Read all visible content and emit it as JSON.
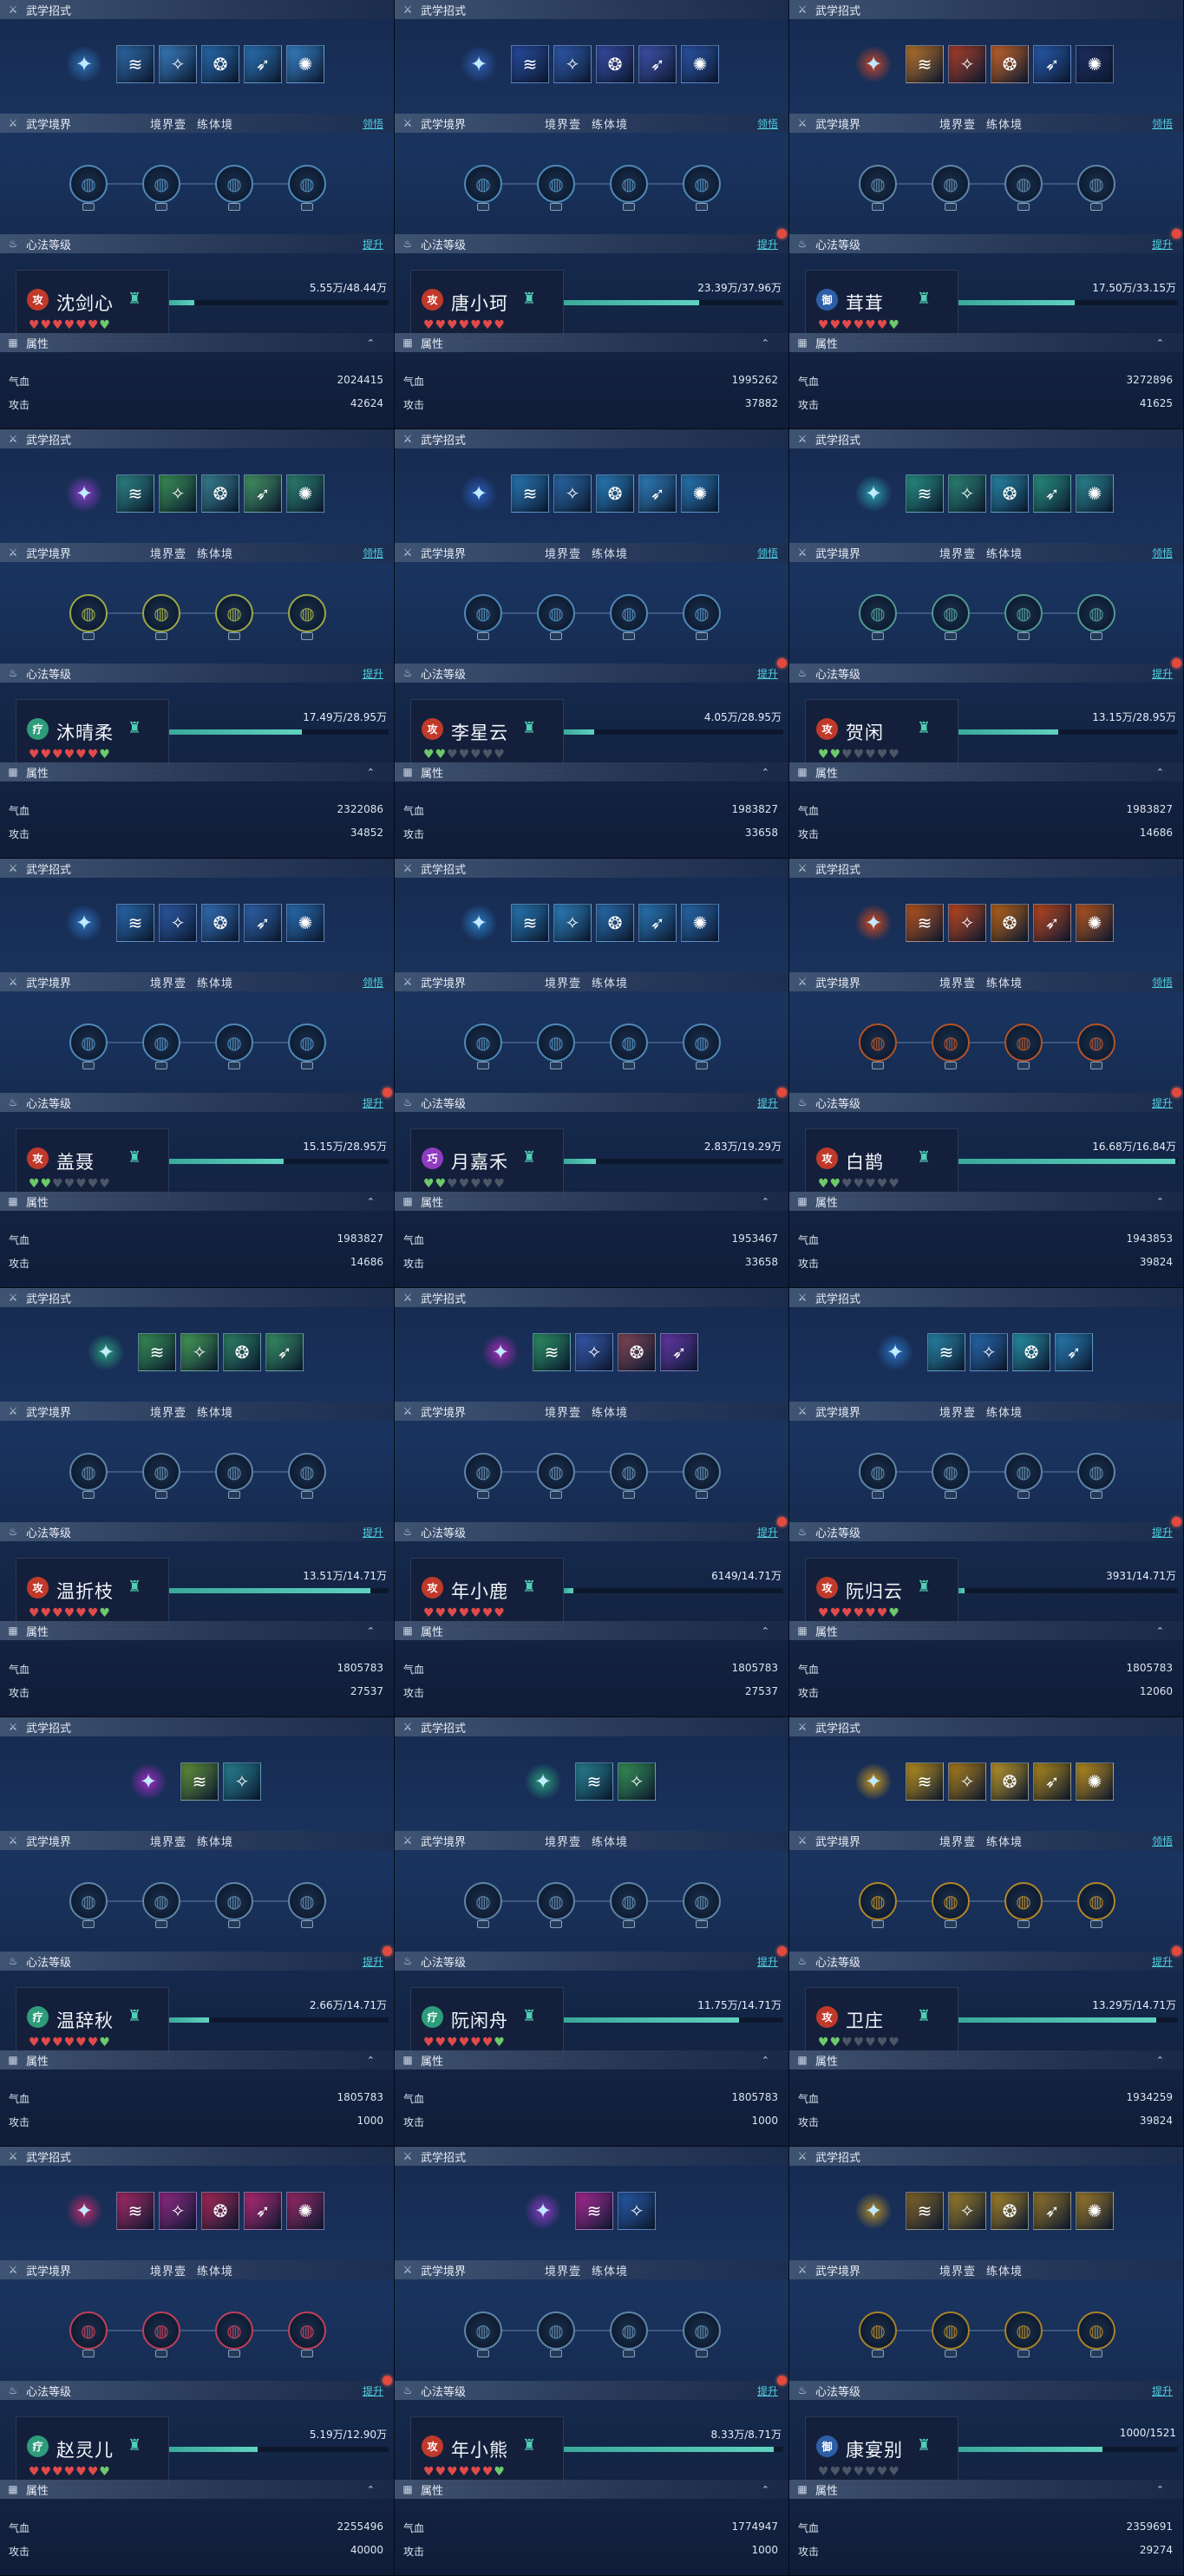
{
  "labels": {
    "skills": "武学招式",
    "realm": "武学境界",
    "realm_options": [
      "境界壹",
      "练体境"
    ],
    "realm_link": "领悟",
    "heart": "心法等级",
    "heart_link": "提升",
    "attr": "属性",
    "hp": "气血",
    "atk": "攻击"
  },
  "colors": {
    "badge_attack": "#c0392b",
    "badge_heal": "#2e9c7a",
    "badge_defense": "#2d5fa8",
    "badge_purple": "#8f3cc2",
    "heart_red": "#e24a4a",
    "heart_green": "#6ec96a",
    "heart_gray": "#4d5566",
    "progress": "#4fc7b0"
  },
  "heroes": [
    {
      "name": "沈剑心",
      "badge": "攻",
      "badge_color": "#c0392b",
      "hearts": [
        "r",
        "r",
        "r",
        "r",
        "r",
        "r",
        "g"
      ],
      "progress_text": "5.55万/48.44万",
      "progress": 0.115,
      "hp": "2024415",
      "atk": "42624",
      "has_dot": false,
      "realm_has_link": true,
      "skill_count": 5,
      "skill_colors": [
        "#2f6fb0",
        "#3c85c9",
        "#2a71b8",
        "#2d7ac0",
        "#3a8ad3"
      ],
      "main_color": "#2d6fb2",
      "node_color": "#4f89b8"
    },
    {
      "name": "唐小珂",
      "badge": "攻",
      "badge_color": "#c0392b",
      "hearts": [
        "r",
        "r",
        "r",
        "r",
        "r",
        "r",
        "r"
      ],
      "progress_text": "23.39万/37.96万",
      "progress": 0.616,
      "hp": "1995262",
      "atk": "37882",
      "has_dot": true,
      "realm_has_link": true,
      "skill_count": 5,
      "skill_colors": [
        "#2a4fa8",
        "#3260b9",
        "#3a4fae",
        "#4357b6",
        "#2c59b0"
      ],
      "main_color": "#2f5db0",
      "node_color": "#4f89b8"
    },
    {
      "name": "茸茸",
      "badge": "御",
      "badge_color": "#2d5fa8",
      "hearts": [
        "r",
        "r",
        "r",
        "r",
        "r",
        "r",
        "g"
      ],
      "progress_text": "17.50万/33.15万",
      "progress": 0.528,
      "hp": "3272896",
      "atk": "41625",
      "has_dot": true,
      "realm_has_link": true,
      "skill_count": 5,
      "skill_colors": [
        "#c47a2a",
        "#b7412a",
        "#d36a2a",
        "#2a5fb6",
        "#1e2e63"
      ],
      "main_color": "#c2452a",
      "node_color": "#5f86a8"
    },
    {
      "name": "沐晴柔",
      "badge": "疗",
      "badge_color": "#2e9c7a",
      "hearts": [
        "r",
        "r",
        "r",
        "r",
        "r",
        "r",
        "g"
      ],
      "progress_text": "17.49万/28.95万",
      "progress": 0.604,
      "hp": "2322086",
      "atk": "34852",
      "has_dot": false,
      "realm_has_link": true,
      "skill_count": 5,
      "skill_colors": [
        "#2f8f8a",
        "#3e9a5a",
        "#3c8a9a",
        "#4aa068",
        "#2f8a76"
      ],
      "main_color": "#8a3cc6",
      "node_color": "#9aa848"
    },
    {
      "name": "李星云",
      "badge": "攻",
      "badge_color": "#c0392b",
      "hearts": [
        "g",
        "g",
        "x",
        "x",
        "x",
        "x",
        "x"
      ],
      "progress_text": "4.05万/28.95万",
      "progress": 0.14,
      "hp": "1983827",
      "atk": "33658",
      "has_dot": true,
      "realm_has_link": true,
      "skill_count": 5,
      "skill_colors": [
        "#2a7fc0",
        "#2c6fb0",
        "#2a86c6",
        "#3488c8",
        "#2a7fbf"
      ],
      "main_color": "#2a5bb8",
      "node_color": "#4f89b8"
    },
    {
      "name": "贺闲",
      "badge": "攻",
      "badge_color": "#c0392b",
      "hearts": [
        "g",
        "g",
        "x",
        "x",
        "x",
        "x",
        "x"
      ],
      "progress_text": "13.15万/28.95万",
      "progress": 0.454,
      "hp": "1983827",
      "atk": "14686",
      "has_dot": true,
      "realm_has_link": true,
      "skill_count": 5,
      "skill_colors": [
        "#2a9a8a",
        "#2e8f7a",
        "#2a8fb0",
        "#2a9a86",
        "#2f8f9a"
      ],
      "main_color": "#2a9aaa",
      "node_color": "#4f9a92"
    },
    {
      "name": "盖聂",
      "badge": "攻",
      "badge_color": "#c0392b",
      "hearts": [
        "g",
        "g",
        "x",
        "x",
        "x",
        "x",
        "x"
      ],
      "progress_text": "15.15万/28.95万",
      "progress": 0.523,
      "hp": "1983827",
      "atk": "14686",
      "has_dot": true,
      "realm_has_link": true,
      "skill_count": 5,
      "skill_colors": [
        "#2a6fb8",
        "#2f5fb0",
        "#3576c2",
        "#3269b6",
        "#2a74bd"
      ],
      "main_color": "#2d6fbc",
      "node_color": "#4f89b8"
    },
    {
      "name": "月嘉禾",
      "badge": "巧",
      "badge_color": "#8f3cc2",
      "hearts": [
        "g",
        "g",
        "x",
        "x",
        "x",
        "x",
        "x"
      ],
      "progress_text": "2.83万/19.29万",
      "progress": 0.147,
      "hp": "1953467",
      "atk": "33658",
      "has_dot": true,
      "realm_has_link": false,
      "skill_count": 5,
      "skill_colors": [
        "#2a7fbf",
        "#2f8ac8",
        "#2a74b8",
        "#2b80c2",
        "#2a6fb6"
      ],
      "main_color": "#2a7abf",
      "node_color": "#4f89b8"
    },
    {
      "name": "白鹊",
      "badge": "攻",
      "badge_color": "#c0392b",
      "hearts": [
        "g",
        "g",
        "x",
        "x",
        "x",
        "x",
        "x"
      ],
      "progress_text": "16.68万/16.84万",
      "progress": 0.99,
      "hp": "1943853",
      "atk": "39824",
      "has_dot": true,
      "realm_has_link": true,
      "skill_count": 5,
      "skill_colors": [
        "#c65a1e",
        "#cc4a1e",
        "#c46a1a",
        "#c84a1e",
        "#c25a1e"
      ],
      "main_color": "#d0481e",
      "node_color": "#b2542a"
    },
    {
      "name": "温折枝",
      "badge": "攻",
      "badge_color": "#c0392b",
      "hearts": [
        "r",
        "r",
        "r",
        "r",
        "r",
        "r",
        "g"
      ],
      "progress_text": "13.51万/14.71万",
      "progress": 0.918,
      "hp": "1805783",
      "atk": "27537",
      "has_dot": false,
      "realm_has_link": false,
      "skill_count": 4,
      "skill_colors": [
        "#3a9a5a",
        "#4aa85a",
        "#2f8a6a",
        "#3a9a6a"
      ],
      "main_color": "#2a9a7a",
      "node_color": "#5f86a8"
    },
    {
      "name": "年小鹿",
      "badge": "攻",
      "badge_color": "#c0392b",
      "hearts": [
        "r",
        "r",
        "r",
        "r",
        "r",
        "r",
        "r"
      ],
      "progress_text": "6149/14.71万",
      "progress": 0.042,
      "hp": "1805783",
      "atk": "27537",
      "has_dot": true,
      "realm_has_link": false,
      "skill_count": 4,
      "skill_colors": [
        "#2f9a6a",
        "#3a5fb8",
        "#8a4a5a",
        "#6a3ab0"
      ],
      "main_color": "#a82ab8",
      "node_color": "#5f86a8"
    },
    {
      "name": "阮归云",
      "badge": "攻",
      "badge_color": "#c0392b",
      "hearts": [
        "r",
        "r",
        "r",
        "r",
        "r",
        "r",
        "g"
      ],
      "progress_text": "3931/14.71万",
      "progress": 0.027,
      "hp": "1805783",
      "atk": "12060",
      "has_dot": true,
      "realm_has_link": false,
      "skill_count": 4,
      "skill_colors": [
        "#2a8fb0",
        "#2a6fb8",
        "#2a9ab0",
        "#2a86c0"
      ],
      "main_color": "#2a6fbf",
      "node_color": "#5f86a8"
    },
    {
      "name": "温辞秋",
      "badge": "疗",
      "badge_color": "#2e9c7a",
      "hearts": [
        "r",
        "r",
        "r",
        "r",
        "r",
        "r",
        "g"
      ],
      "progress_text": "2.66万/14.71万",
      "progress": 0.181,
      "hp": "1805783",
      "atk": "1000",
      "has_dot": true,
      "realm_has_link": false,
      "skill_count": 2,
      "skill_colors": [
        "#6a9a3a",
        "#2a8a9a"
      ],
      "main_color": "#a02ac0",
      "node_color": "#5f86a8"
    },
    {
      "name": "阮闲舟",
      "badge": "疗",
      "badge_color": "#2e9c7a",
      "hearts": [
        "r",
        "r",
        "r",
        "r",
        "r",
        "r",
        "g"
      ],
      "progress_text": "11.75万/14.71万",
      "progress": 0.799,
      "hp": "1805783",
      "atk": "1000",
      "has_dot": true,
      "realm_has_link": false,
      "skill_count": 2,
      "skill_colors": [
        "#2a8a9a",
        "#3a9a5a"
      ],
      "main_color": "#2a9a7a",
      "node_color": "#5f86a8"
    },
    {
      "name": "卫庄",
      "badge": "攻",
      "badge_color": "#c0392b",
      "hearts": [
        "g",
        "g",
        "x",
        "x",
        "x",
        "x",
        "x"
      ],
      "progress_text": "13.29万/14.71万",
      "progress": 0.903,
      "hp": "1934259",
      "atk": "39824",
      "has_dot": true,
      "realm_has_link": true,
      "skill_count": 5,
      "skill_colors": [
        "#c89a1e",
        "#b8861a",
        "#c8a02a",
        "#b8901a",
        "#c8961e"
      ],
      "main_color": "#c8941a",
      "node_color": "#b2862a"
    },
    {
      "name": "赵灵儿",
      "badge": "疗",
      "badge_color": "#2e9c7a",
      "hearts": [
        "r",
        "r",
        "r",
        "r",
        "r",
        "r",
        "g"
      ],
      "progress_text": "5.19万/12.90万",
      "progress": 0.402,
      "hp": "2255496",
      "atk": "40000",
      "has_dot": true,
      "realm_has_link": false,
      "skill_count": 5,
      "skill_colors": [
        "#b02a6a",
        "#9a2a8a",
        "#b02a5a",
        "#c02a7a",
        "#a02a6a"
      ],
      "main_color": "#c02a6a",
      "node_color": "#c0405a"
    },
    {
      "name": "年小熊",
      "badge": "攻",
      "badge_color": "#c0392b",
      "hearts": [
        "r",
        "r",
        "r",
        "r",
        "r",
        "r",
        "g"
      ],
      "progress_text": "8.33万/8.71万",
      "progress": 0.956,
      "hp": "1774947",
      "atk": "1000",
      "has_dot": true,
      "realm_has_link": false,
      "skill_count": 2,
      "skill_colors": [
        "#b02a9a",
        "#2a5fb0"
      ],
      "main_color": "#8a3ac6",
      "node_color": "#5f86a8"
    },
    {
      "name": "康宴别",
      "badge": "御",
      "badge_color": "#2d5fa8",
      "hearts": [
        "x",
        "x",
        "x",
        "x",
        "x",
        "x",
        "x"
      ],
      "progress_text": "1000/1521",
      "progress": 0.657,
      "hp": "2359691",
      "atk": "29274",
      "has_dot": false,
      "realm_has_link": false,
      "skill_count": 5,
      "skill_colors": [
        "#8a6a2a",
        "#a8862a",
        "#b08a2a",
        "#9a7a2a",
        "#a8822a"
      ],
      "main_color": "#b08a2a",
      "node_color": "#a8822a"
    }
  ]
}
